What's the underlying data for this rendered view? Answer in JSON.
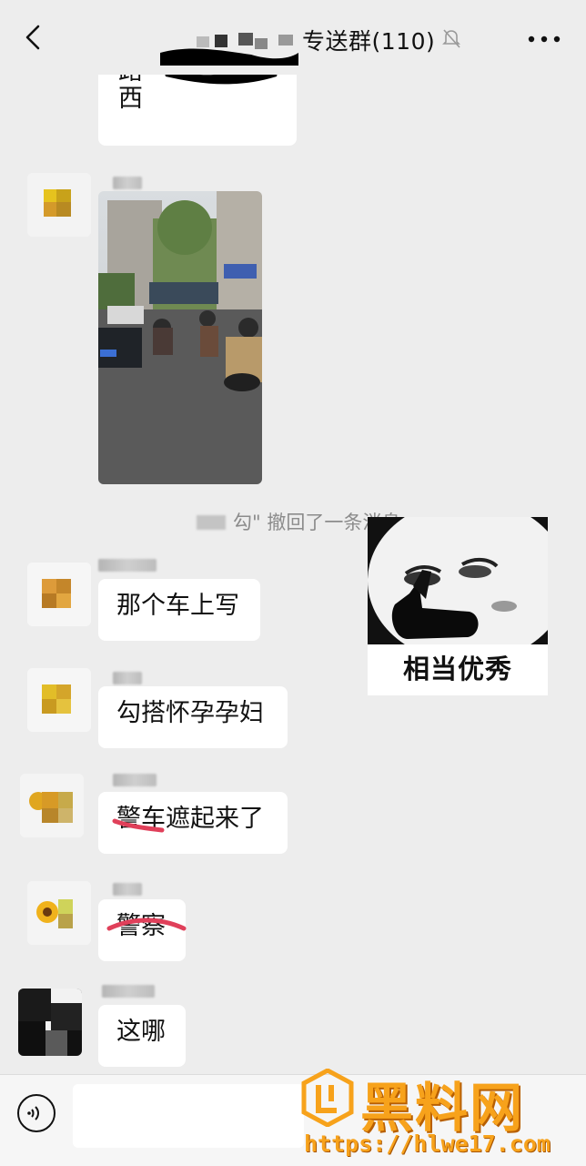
{
  "header": {
    "title": "████专送群(110)",
    "title_visible": "专送群(110)"
  },
  "top_message": {
    "partial_text": "路西"
  },
  "system_notice": "勾\" 撤回了一条消息",
  "sticker": {
    "caption": "相当优秀"
  },
  "messages": [
    {
      "text": "那个车上写"
    },
    {
      "text": "勾搭怀孕孕妇"
    },
    {
      "text": "警车遮起来了"
    },
    {
      "text": "警察"
    },
    {
      "text": "这哪"
    }
  ],
  "watermark": {
    "brand": "黑料网",
    "url": "https://hlwe17.com"
  },
  "colors": {
    "background": "#ededed",
    "bubble": "#ffffff",
    "system_text": "#8c8c8c",
    "watermark": "#f7a21b",
    "strike": "#e0405a"
  }
}
